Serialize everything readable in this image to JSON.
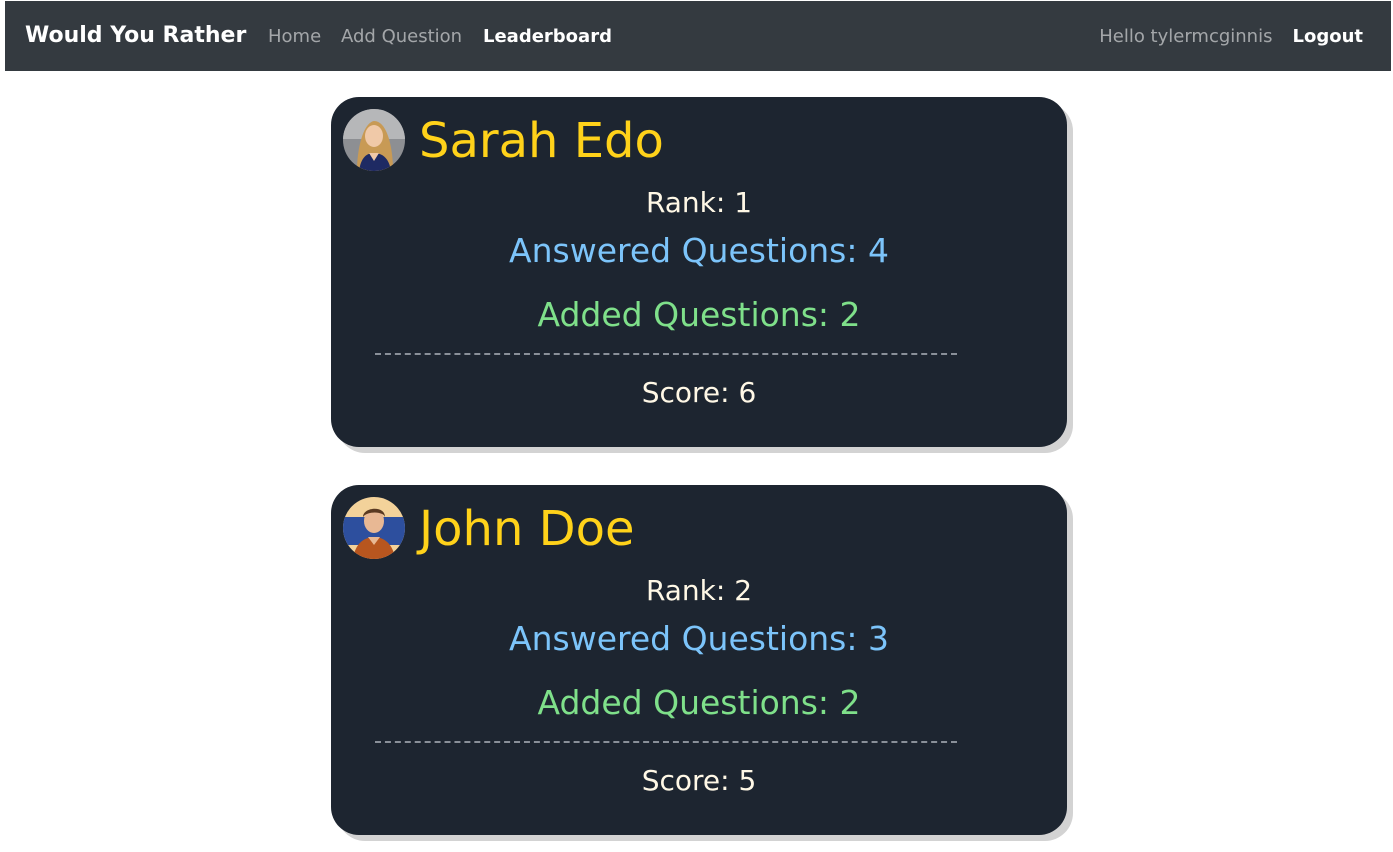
{
  "navbar": {
    "brand": "Would You Rather",
    "links": [
      {
        "label": "Home"
      },
      {
        "label": "Add Question"
      },
      {
        "label": "Leaderboard"
      }
    ],
    "greeting": "Hello tylermcginnis",
    "logout_label": "Logout"
  },
  "leaderboard": [
    {
      "name": "Sarah Edo",
      "rank_label": "Rank: 1",
      "answered_label": "Answered Questions: 4",
      "added_label": "Added Questions: 2",
      "score_label": "Score: 6"
    },
    {
      "name": "John Doe",
      "rank_label": "Rank: 2",
      "answered_label": "Answered Questions: 3",
      "added_label": "Added Questions: 2",
      "score_label": "Score: 5"
    }
  ],
  "colors": {
    "navbar_bg": "#343a40",
    "card_bg": "#1d2530",
    "name": "#ffd21a",
    "answered": "#7cc4fa",
    "added": "#7fe08a"
  }
}
